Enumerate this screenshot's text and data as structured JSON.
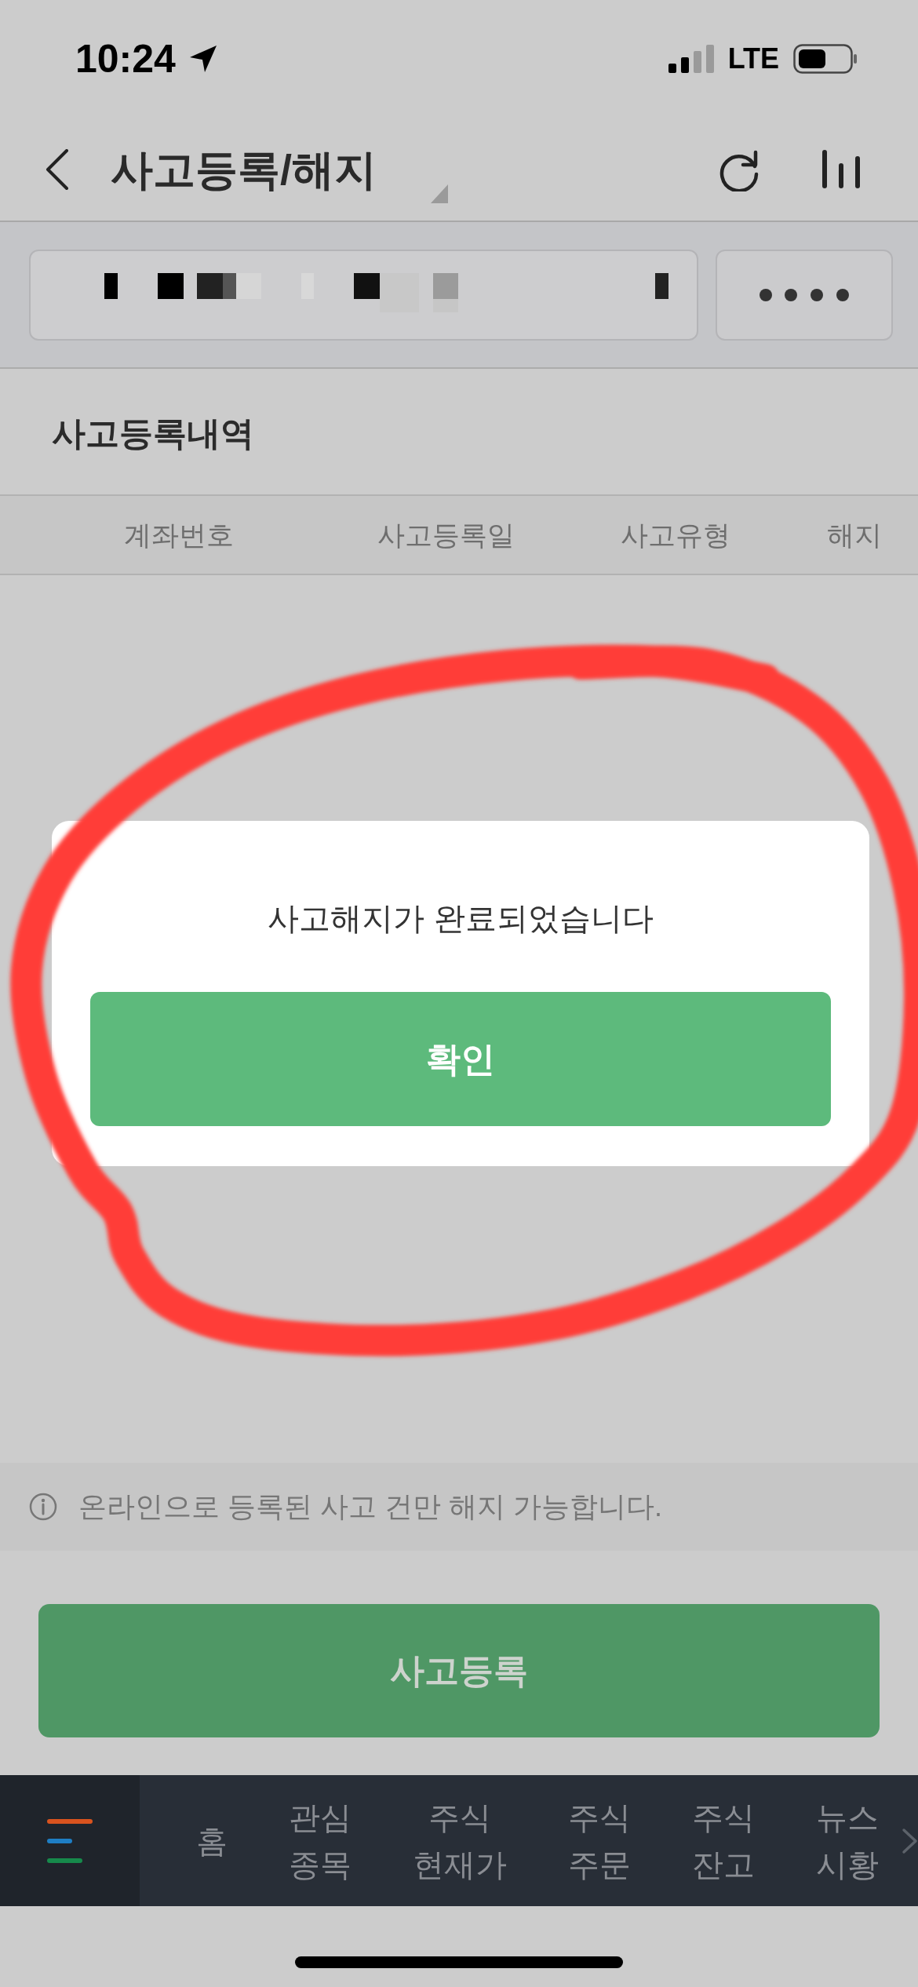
{
  "status_bar": {
    "time": "10:24",
    "network": "LTE"
  },
  "header": {
    "title": "사고등록/해지"
  },
  "section": {
    "title": "사고등록내역"
  },
  "table": {
    "columns": [
      "계좌번호",
      "사고등록일",
      "사고유형",
      "해지"
    ]
  },
  "dialog": {
    "message": "사고해지가 완료되었습니다",
    "confirm_button": "확인"
  },
  "notice": {
    "text": "온라인으로 등록된 사고 건만 해지 가능합니다."
  },
  "register_button": "사고등록",
  "tab_bar": {
    "tabs": [
      {
        "label": "홈",
        "selected": false
      },
      {
        "label": "관심\n종목",
        "selected": false
      },
      {
        "label": "주식\n현재가",
        "selected": false
      },
      {
        "label": "주식\n주문",
        "selected": false
      },
      {
        "label": "주식\n잔고",
        "selected": false
      },
      {
        "label": "뉴스\n시황",
        "selected": false
      }
    ]
  }
}
